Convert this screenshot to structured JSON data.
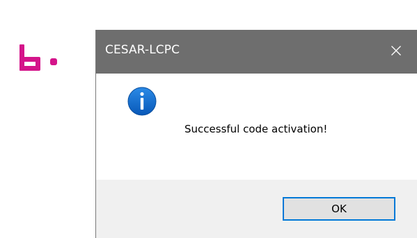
{
  "step_marker": {
    "label": "b.",
    "color": "#d4148a"
  },
  "dialog": {
    "title": "CESAR-LCPC",
    "close_icon": "close-icon",
    "icon": "info-icon",
    "message": "Successful code activation!",
    "ok_label": "OK",
    "colors": {
      "titlebar": "#6e6e6e",
      "footer": "#f0f0f0",
      "button_border": "#0078d7",
      "info_icon": "#0a64c8"
    }
  }
}
